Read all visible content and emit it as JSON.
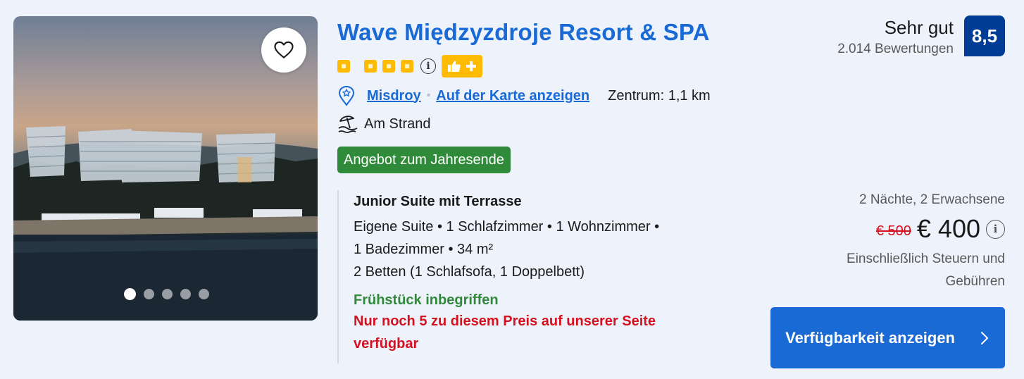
{
  "hotel": {
    "name": "Wave Międzyzdroje Resort & SPA",
    "star_count": 4,
    "info_icon": "i",
    "badge_icons": [
      "thumbs-up-icon",
      "plus-icon"
    ],
    "location_icon": "map-pin-icon",
    "location_link": "Misdroy",
    "map_link": "Auf der Karte anzeigen",
    "distance": "Zentrum: 1,1 km",
    "beach_icon": "beach-umbrella-icon",
    "beach_label": "Am Strand",
    "deal_badge": "Angebot zum Jahresende"
  },
  "photo": {
    "favorite_icon": "heart-icon",
    "slide_count": 5,
    "active_slide": 1
  },
  "room": {
    "name": "Junior Suite mit Terrasse",
    "detail_line1": "Eigene Suite • 1 Schlafzimmer • 1 Wohnzimmer •",
    "detail_line2": "1 Badezimmer • 34 m²",
    "detail_line3": "2 Betten (1 Schlafsofa, 1 Doppelbett)",
    "breakfast": "Frühstück inbegriffen",
    "scarcity": "Nur noch 5 zu diesem Preis auf unserer Seite verfügbar"
  },
  "review": {
    "label": "Sehr gut",
    "count": "2.014 Bewertungen",
    "score": "8,5"
  },
  "pricing": {
    "stay_summary": "2 Nächte, 2 Erwachsene",
    "old_price": "€ 500",
    "new_price": "€ 400",
    "info_icon": "i",
    "taxes_note": "Einschließlich Steuern und Gebühren"
  },
  "cta": {
    "label": "Verfügbarkeit anzeigen",
    "icon": "chevron-right-icon"
  },
  "colors": {
    "brand_blue": "#1a6ad6",
    "score_navy": "#003b95",
    "star_yellow": "#febb02",
    "deal_green": "#2f8a3a",
    "alert_red": "#d4111e",
    "background": "#eef2fb"
  }
}
